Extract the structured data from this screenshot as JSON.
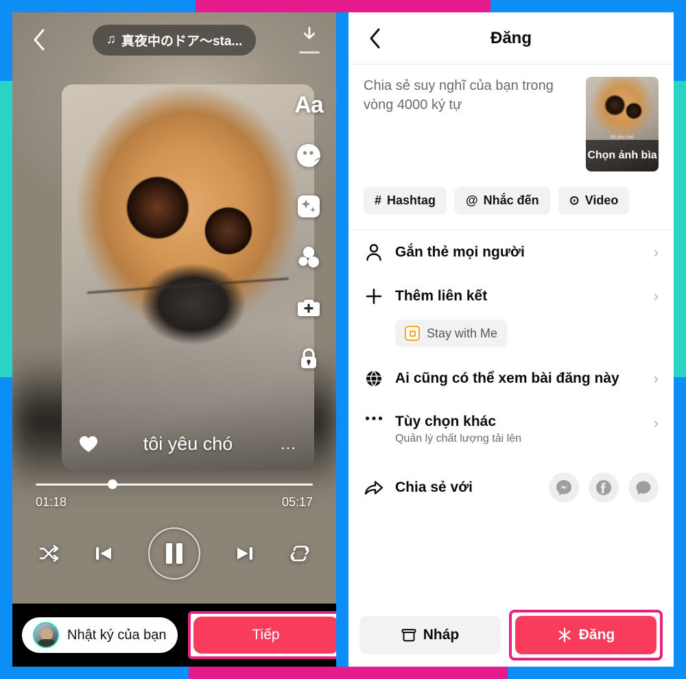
{
  "frame": {
    "colors": {
      "blue": "#0d8ef7",
      "magenta": "#e51b8d",
      "teal": "#2ad4c4"
    }
  },
  "left_panel": {
    "back_icon": "chevron-left-icon",
    "music_pill": {
      "icon": "music-note-icon",
      "label": "真夜中のドア〜sta..."
    },
    "download_icon": "download-icon",
    "tool_rail": [
      {
        "name": "text-tool",
        "icon": "aa-text-icon",
        "label": "Aa"
      },
      {
        "name": "sticker-tool",
        "icon": "sticker-face-icon",
        "label": ""
      },
      {
        "name": "effects-tool",
        "icon": "sparkle-icon",
        "label": ""
      },
      {
        "name": "blob-sticker-tool",
        "icon": "blobs-icon",
        "label": ""
      },
      {
        "name": "add-media-tool",
        "icon": "camera-plus-icon",
        "label": ""
      },
      {
        "name": "privacy-tool",
        "icon": "lock-icon",
        "label": ""
      }
    ],
    "video_caption": {
      "text": "tôi yêu chó",
      "heart_icon": "heart-icon",
      "more_icon": "ellipsis-icon"
    },
    "player": {
      "current_time": "01:18",
      "total_time": "05:17",
      "progress_percent": 26,
      "controls": [
        {
          "name": "shuffle-button",
          "icon": "shuffle-icon"
        },
        {
          "name": "previous-button",
          "icon": "skip-previous-icon"
        },
        {
          "name": "pause-button",
          "icon": "pause-icon"
        },
        {
          "name": "next-button",
          "icon": "skip-next-icon"
        },
        {
          "name": "repeat-button",
          "icon": "repeat-icon"
        }
      ]
    },
    "bottom": {
      "story_label": "Nhật ký của bạn",
      "avatar_icon": "avatar",
      "next_label": "Tiếp",
      "next_highlight_color": "#e5237e",
      "next_button_color": "#fa3c5c"
    }
  },
  "right_panel": {
    "header": {
      "back_icon": "chevron-left-icon",
      "title": "Đăng"
    },
    "compose": {
      "placeholder": "Chia sẻ suy nghĩ của bạn trong vòng 4000 ký tự",
      "cover": {
        "label": "Chọn ảnh bìa",
        "mini_caption": "tôi yêu chó"
      }
    },
    "chips": [
      {
        "icon": "hashtag-icon",
        "glyph": "#",
        "label": "Hashtag"
      },
      {
        "icon": "mention-icon",
        "glyph": "@",
        "label": "Nhắc đến"
      },
      {
        "icon": "video-circle-icon",
        "glyph": "⊙",
        "label": "Video"
      }
    ],
    "rows": [
      {
        "icon": "person-icon",
        "label": "Gắn thẻ mọi người",
        "sub": "",
        "chevron": "›"
      },
      {
        "icon": "plus-icon",
        "label": "Thêm liên kết",
        "sub": "",
        "chevron": "›"
      },
      {
        "icon": "globe-icon",
        "label": "Ai cũng có thể xem bài đăng này",
        "sub": "",
        "chevron": "›"
      },
      {
        "icon": "ellipsis-icon",
        "label": "Tùy chọn khác",
        "sub": "Quản lý chất lượng tải lên",
        "chevron": "›"
      }
    ],
    "link_chip": {
      "icon": "music-app-icon",
      "label": "Stay with Me"
    },
    "share": {
      "icon": "share-arrow-icon",
      "label": "Chia sẻ với",
      "targets": [
        {
          "name": "share-messenger",
          "icon": "messenger-icon"
        },
        {
          "name": "share-facebook",
          "icon": "facebook-icon"
        },
        {
          "name": "share-sms",
          "icon": "message-bubble-icon"
        }
      ]
    },
    "bottom": {
      "draft_icon": "archive-box-icon",
      "draft_label": "Nháp",
      "post_icon": "sparkle-star-icon",
      "post_label": "Đăng",
      "post_highlight_color": "#e5237e",
      "post_button_color": "#fa3c5c"
    }
  }
}
